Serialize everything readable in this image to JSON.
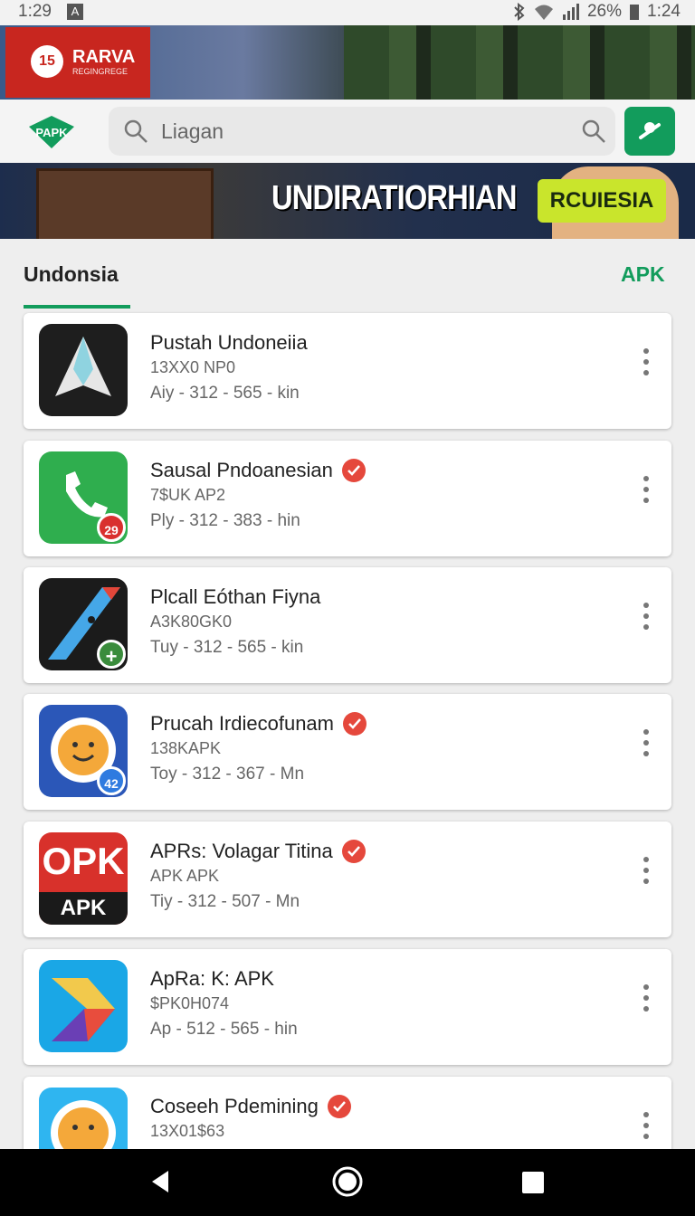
{
  "status": {
    "time": "1:29",
    "app_badge": "A",
    "battery": "26%",
    "clock_right": "1:24"
  },
  "banner": {
    "brand": "RARVA",
    "brand_sub": "REGINGREGE",
    "logo_text": "15"
  },
  "header": {
    "logo_text": "PAPK",
    "search_placeholder": "Liagan"
  },
  "promo": {
    "title": "UNDIRATIORHIAN",
    "button": "RCUIESIA"
  },
  "tabs": [
    {
      "label": "Undonsia"
    },
    {
      "label": "APK"
    }
  ],
  "apps": [
    {
      "name": "Pustah Undoneiia",
      "sub": "13XX0 NP0",
      "meta": "Aiy  -  312  -  565  -  kin",
      "verified": false,
      "badge": ""
    },
    {
      "name": "Sausal Pndoanesian",
      "sub": "7$UK AP2",
      "meta": "Ply  -  312  -  383  -  hin",
      "verified": true,
      "badge": "29"
    },
    {
      "name": "Plcall Eóthan Fiyna",
      "sub": "A3K80GK0",
      "meta": "Tuy  -  312  -  565  -  kin",
      "verified": false,
      "badge": "+"
    },
    {
      "name": "Prucah Irdiecofunam",
      "sub": "138KAPK",
      "meta": "Toy  -  312  -  367  -  Mn",
      "verified": true,
      "badge": "42"
    },
    {
      "name": "APRs: Volagar Titina",
      "sub": "APK  APK",
      "meta": "Tiy  -  312  -  507  -  Mn",
      "verified": true,
      "badge": "",
      "icon_top": "OPK",
      "icon_bottom": "APK"
    },
    {
      "name": "ApRa: K: APK",
      "sub": "$PK0H074",
      "meta": "Ap  -  512  -  565  -  hin",
      "verified": false,
      "badge": ""
    },
    {
      "name": "Coseeh Pdemining",
      "sub": "13X01$63",
      "meta": "",
      "verified": true,
      "badge": ""
    }
  ],
  "colors": {
    "accent": "#129c5c",
    "verified": "#e5483c"
  }
}
